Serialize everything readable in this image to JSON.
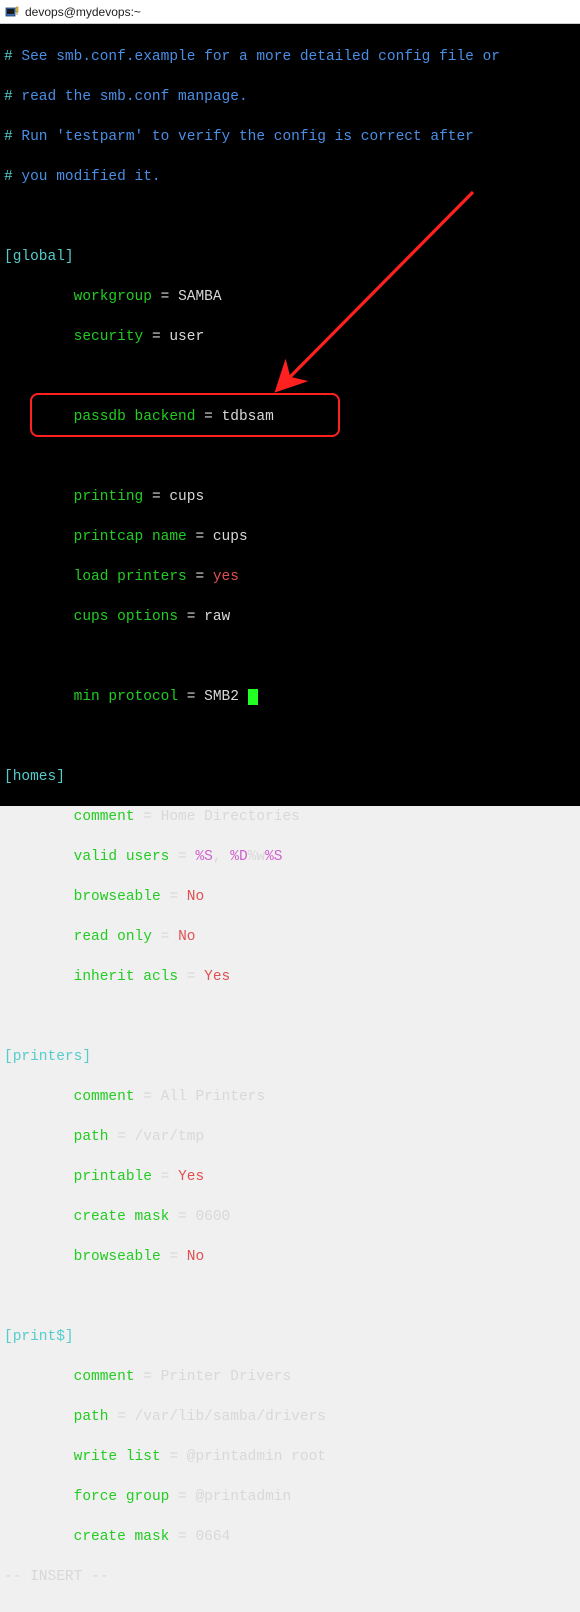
{
  "window": {
    "title": "devops@mydevops:~"
  },
  "comments": {
    "c0_prefix": "#",
    "c0_text": " See smb.conf.example for a more detailed config file or",
    "c1_prefix": "#",
    "c1_text": " read the smb.conf manpage.",
    "c2_prefix": "#",
    "c2_text": " Run 'testparm' to verify the config is correct after",
    "c3_prefix": "#",
    "c3_text": " you modified it."
  },
  "sections": {
    "global_open": "[global]",
    "homes_open": "[homes]",
    "printers_open": "[printers]",
    "print_dollar_open": "[print$]"
  },
  "global": {
    "indent": "        ",
    "workgroup_key": "workgroup",
    "workgroup_eq": " = ",
    "workgroup_val": "SAMBA",
    "security_key": "security",
    "security_eq": " = ",
    "security_val": "user",
    "passdb_key": "passdb backend",
    "passdb_eq": " = ",
    "passdb_val": "tdbsam",
    "printing_key": "printing",
    "printing_eq": " = ",
    "printing_val": "cups",
    "printcap_key": "printcap name",
    "printcap_eq": " = ",
    "printcap_val": "cups",
    "loadprn_key": "load printers",
    "loadprn_eq": " = ",
    "loadprn_val": "yes",
    "cupsopt_key": "cups options",
    "cupsopt_eq": " = ",
    "cupsopt_val": "raw",
    "minproto_key": "min protocol",
    "minproto_eq": " = ",
    "minproto_val": "SMB2 "
  },
  "homes": {
    "comment_key": "comment",
    "comment_eq": " = ",
    "comment_val": "Home Directories",
    "valid_key": "valid users",
    "valid_eq": " = ",
    "valid_s1": "%S",
    "valid_comma": ", ",
    "valid_d": "%D",
    "valid_w": "%w",
    "valid_s2": "%S",
    "browse_key": "browseable",
    "browse_eq": " = ",
    "browse_val": "No",
    "readonly_key": "read only",
    "readonly_eq": " = ",
    "readonly_val": "No",
    "inherit_key": "inherit acls",
    "inherit_eq": " = ",
    "inherit_val": "Yes"
  },
  "printers": {
    "comment_key": "comment",
    "comment_eq": " = ",
    "comment_val": "All Printers",
    "path_key": "path",
    "path_eq": " = ",
    "path_val": "/var/tmp",
    "print_key": "printable",
    "print_eq": " = ",
    "print_val": "Yes",
    "mask_key": "create mask",
    "mask_eq": " = ",
    "mask_val": "0600",
    "browse_key": "browseable",
    "browse_eq": " = ",
    "browse_val": "No"
  },
  "print_dollar": {
    "comment_key": "comment",
    "comment_eq": " = ",
    "comment_val": "Printer Drivers",
    "path_key": "path",
    "path_eq": " = ",
    "path_val": "/var/lib/samba/drivers",
    "write_key": "write list",
    "write_eq": " = ",
    "write_val": "@printadmin root",
    "force_key": "force group",
    "force_eq": " = ",
    "force_val": "@printadmin",
    "mask_key": "create mask",
    "mask_eq": " = ",
    "mask_val": "0664"
  },
  "vim": {
    "mode": "-- INSERT --"
  }
}
